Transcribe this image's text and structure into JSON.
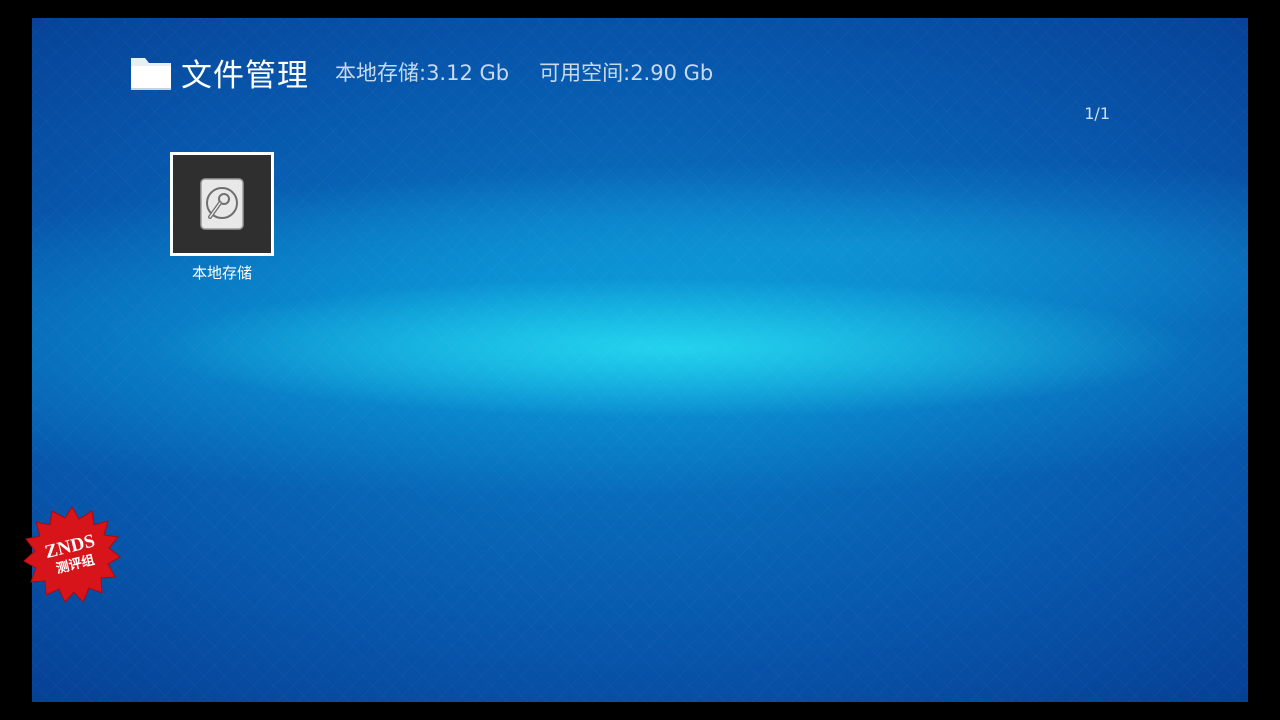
{
  "header": {
    "icon": "folder-icon",
    "title": "文件管理",
    "local_storage": "本地存储:3.12 Gb",
    "free_space": "可用空间:2.90 Gb"
  },
  "pagination": {
    "text": "1/1"
  },
  "items": [
    {
      "icon": "hard-drive-icon",
      "label": "本地存储",
      "selected": true
    }
  ],
  "watermark": {
    "text_line1": "ZNDS",
    "text_line2": "测评组",
    "color": "#d8141b"
  },
  "colors": {
    "background_dark": "#06378c",
    "background_glow": "#28dcf0",
    "tile_bg": "#2f2f2f",
    "text_primary": "#ffffff"
  }
}
